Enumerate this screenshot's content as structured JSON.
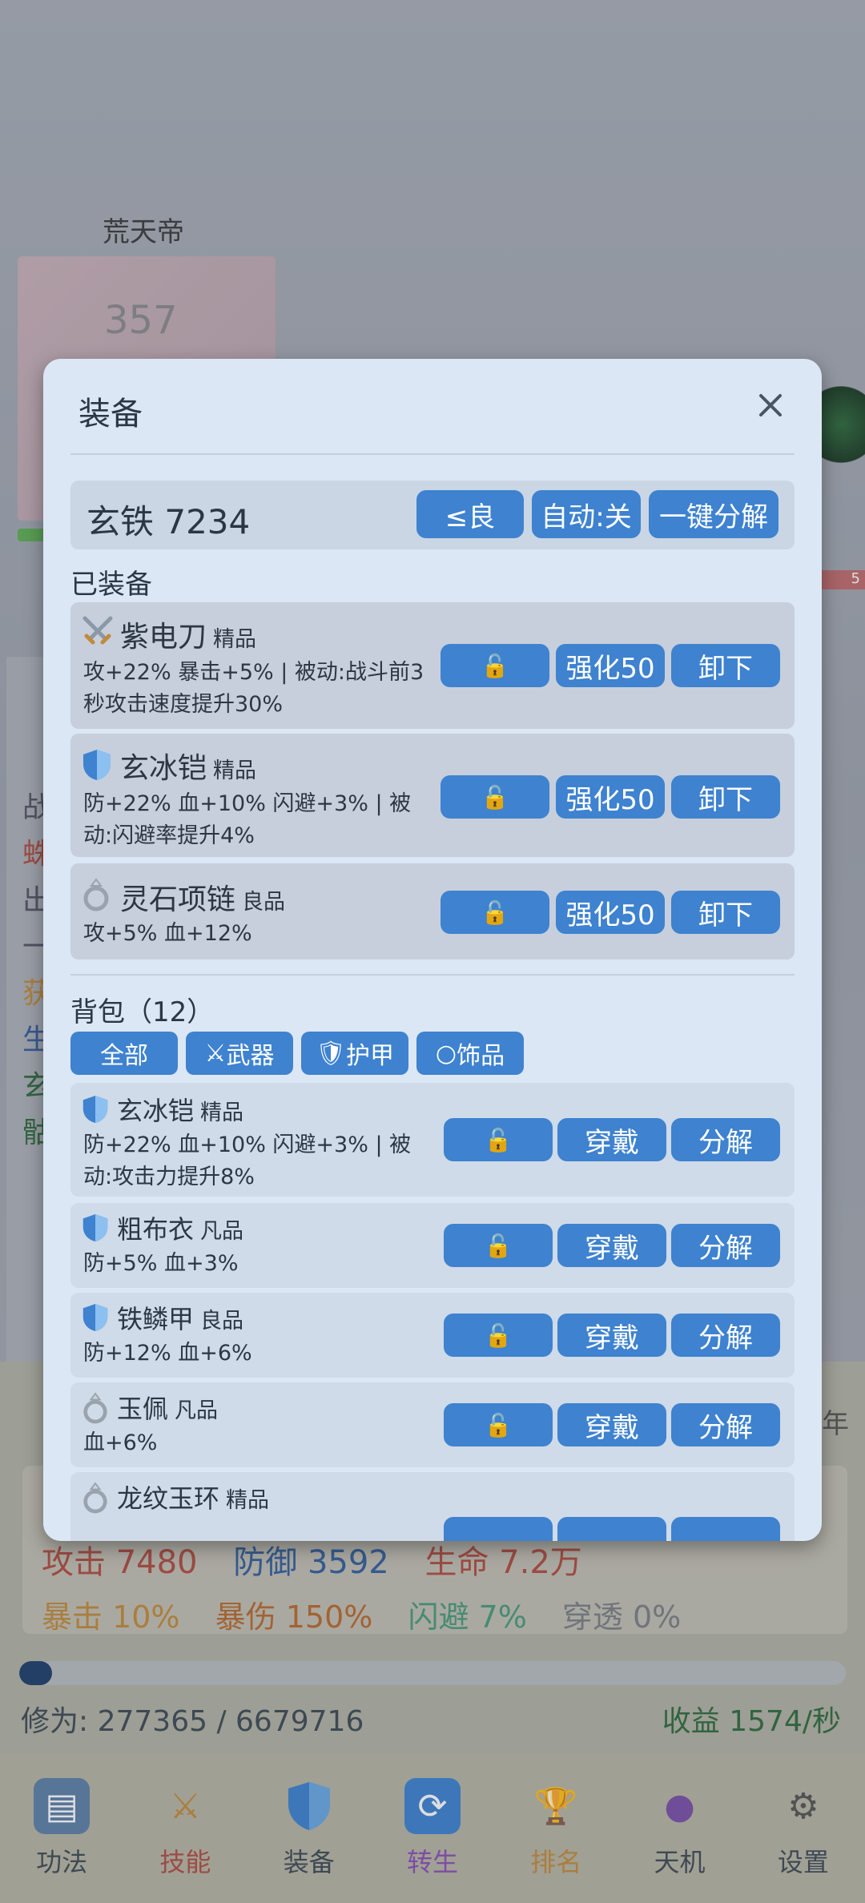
{
  "background": {
    "hero_name": "荒天帝",
    "hero_level": "357",
    "year_mark": "年",
    "stats_row1": {
      "atk": "攻击 7480",
      "def": "防御 3592",
      "hp": "生命 7.2万"
    },
    "stats_row2": {
      "crit": "暴击 10%",
      "crit_dmg": "暴伤 150%",
      "dodge": "闪避 7%",
      "pen": "穿透 0%"
    },
    "cultivation": "修为: 277365 / 6679716",
    "cultivation_progress": 0.04,
    "income": "收益 1574/秒",
    "side_chars": [
      "战",
      "蛛",
      "出",
      "一",
      "获",
      "生",
      "玄",
      "骷"
    ]
  },
  "tabbar": [
    {
      "label": "功法",
      "icon": "book-icon",
      "color": "#3d4a55"
    },
    {
      "label": "技能",
      "icon": "crossed-swords-icon",
      "color": "#b14c40"
    },
    {
      "label": "装备",
      "icon": "shield-icon",
      "color": "#3d4a55"
    },
    {
      "label": "转生",
      "icon": "cycle-icon",
      "color": "#8a4fb8"
    },
    {
      "label": "排名",
      "icon": "trophy-icon",
      "color": "#c28a3a"
    },
    {
      "label": "天机",
      "icon": "crystal-ball-icon",
      "color": "#3d4a55"
    },
    {
      "label": "设置",
      "icon": "gear-icon",
      "color": "#3d4a55"
    }
  ],
  "modal": {
    "title": "装备",
    "currency": "玄铁 7234",
    "filter_quality_btn": "≤良",
    "auto_btn": "自动:关",
    "decompose_all_btn": "一键分解",
    "equipped_label": "已装备",
    "bag_label": "背包（12）",
    "filters": [
      "全部",
      "武器",
      "护甲",
      "饰品"
    ],
    "equipped": [
      {
        "name": "紫电刀",
        "quality": "精品",
        "icon": "crossed-swords-icon",
        "desc": "攻+22% 暴击+5% | 被动:战斗前3秒攻击速度提升30%",
        "btn1": "🔓",
        "btn2": "强化50",
        "btn3": "卸下"
      },
      {
        "name": "玄冰铠",
        "quality": "精品",
        "icon": "shield-icon",
        "desc": "防+22% 血+10% 闪避+3% | 被动:闪避率提升4%",
        "btn1": "🔓",
        "btn2": "强化50",
        "btn3": "卸下"
      },
      {
        "name": "灵石项链",
        "quality": "良品",
        "icon": "ring-icon",
        "desc": "攻+5% 血+12%",
        "btn1": "🔓",
        "btn2": "强化50",
        "btn3": "卸下"
      }
    ],
    "bag": [
      {
        "name": "玄冰铠",
        "quality": "精品",
        "icon": "shield-icon",
        "desc": "防+22% 血+10% 闪避+3% | 被动:攻击力提升8%",
        "btn1": "🔓",
        "btn2": "穿戴",
        "btn3": "分解"
      },
      {
        "name": "粗布衣",
        "quality": "凡品",
        "icon": "shield-icon",
        "desc": "防+5% 血+3%",
        "btn1": "🔓",
        "btn2": "穿戴",
        "btn3": "分解"
      },
      {
        "name": "铁鳞甲",
        "quality": "良品",
        "icon": "shield-icon",
        "desc": "防+12% 血+6%",
        "btn1": "🔓",
        "btn2": "穿戴",
        "btn3": "分解"
      },
      {
        "name": "玉佩",
        "quality": "凡品",
        "icon": "ring-icon",
        "desc": "血+6%",
        "btn1": "🔓",
        "btn2": "穿戴",
        "btn3": "分解"
      },
      {
        "name": "龙纹玉环",
        "quality": "精品",
        "icon": "ring-icon",
        "desc": "",
        "btn1": "",
        "btn2": "",
        "btn3": ""
      }
    ]
  }
}
